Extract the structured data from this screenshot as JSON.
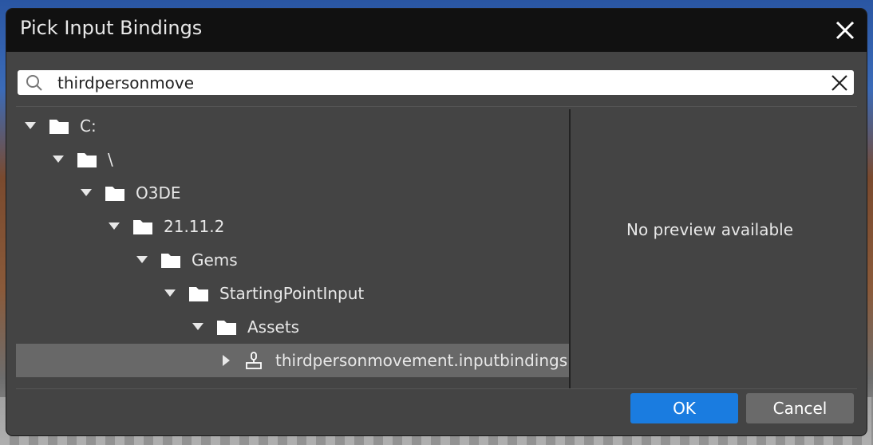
{
  "dialog": {
    "title": "Pick Input Bindings",
    "close_icon": "close-icon"
  },
  "search": {
    "value": "thirdpersonmove",
    "search_icon": "search-icon",
    "clear_icon": "clear-icon"
  },
  "tree": {
    "rows": [
      {
        "label": "C:",
        "type": "folder",
        "expanded": true
      },
      {
        "label": "\\",
        "type": "folder",
        "expanded": true
      },
      {
        "label": "O3DE",
        "type": "folder",
        "expanded": true
      },
      {
        "label": "21.11.2",
        "type": "folder",
        "expanded": true
      },
      {
        "label": "Gems",
        "type": "folder",
        "expanded": true
      },
      {
        "label": "StartingPointInput",
        "type": "folder",
        "expanded": true
      },
      {
        "label": "Assets",
        "type": "folder",
        "expanded": true
      },
      {
        "label": "thirdpersonmovement.inputbindings",
        "type": "file",
        "expanded": false,
        "selected": true
      }
    ]
  },
  "preview": {
    "text": "No preview available"
  },
  "buttons": {
    "ok_label": "OK",
    "cancel_label": "Cancel"
  },
  "colors": {
    "accent": "#1a7ce0",
    "dialog_bg": "#444444",
    "titlebar_bg": "#111111",
    "selected_row": "#686868"
  }
}
